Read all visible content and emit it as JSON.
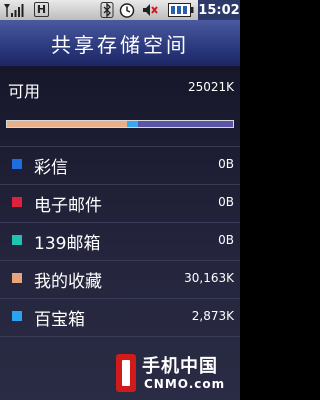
{
  "status_bar": {
    "h_indicator": "H",
    "time": "15:02"
  },
  "title": "共享存储空间",
  "available": {
    "label": "可用",
    "value": "25021K"
  },
  "usage_bar": {
    "used_fraction_segment1": 0.53,
    "used_fraction_segment2": 0.05,
    "colors": {
      "segment1": "#e7b08a",
      "segment2": "#38a8f0",
      "free": "#5a55a8"
    }
  },
  "items": [
    {
      "label": "彩信",
      "value": "0B",
      "color": "#1f6ee0"
    },
    {
      "label": "电子邮件",
      "value": "0B",
      "color": "#e0213e"
    },
    {
      "label": "139邮箱",
      "value": "0B",
      "color": "#1ec4b0"
    },
    {
      "label": "我的收藏",
      "value": "30,163K",
      "color": "#e7a47a"
    },
    {
      "label": "百宝箱",
      "value": "2,873K",
      "color": "#28a4f0"
    }
  ],
  "watermark": {
    "cn": "手机中国",
    "en": "CNMO.com"
  }
}
